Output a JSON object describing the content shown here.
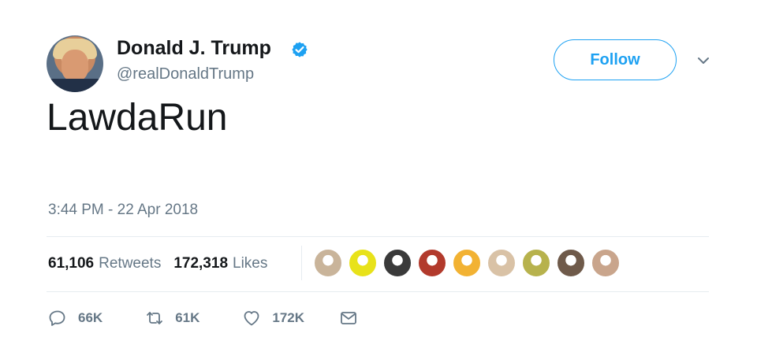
{
  "author": {
    "name": "Donald J. Trump",
    "handle": "@realDonaldTrump",
    "verified": true
  },
  "follow_label": "Follow",
  "tweet_text": "LawdaRun",
  "timestamp": "3:44 PM - 22 Apr 2018",
  "stats": {
    "retweets_count": "61,106",
    "retweets_label": "Retweets",
    "likes_count": "172,318",
    "likes_label": "Likes"
  },
  "likers": [
    {
      "icon": "liker-avatar-1",
      "color": "#c9b49a"
    },
    {
      "icon": "liker-avatar-2",
      "color": "#e8e21a"
    },
    {
      "icon": "liker-avatar-3",
      "color": "#3a3a3a"
    },
    {
      "icon": "liker-avatar-4",
      "color": "#b23a2c"
    },
    {
      "icon": "liker-avatar-5",
      "color": "#f2b233"
    },
    {
      "icon": "liker-avatar-6",
      "color": "#d9c2a6"
    },
    {
      "icon": "liker-avatar-7",
      "color": "#b7b24d"
    },
    {
      "icon": "liker-avatar-8",
      "color": "#6f5a4a"
    },
    {
      "icon": "liker-avatar-9",
      "color": "#c9a58c"
    }
  ],
  "actions": {
    "reply_count": "66K",
    "retweet_count": "61K",
    "like_count": "172K"
  },
  "colors": {
    "accent": "#1da1f2",
    "secondary_text": "#657786",
    "primary_text": "#14171a"
  }
}
